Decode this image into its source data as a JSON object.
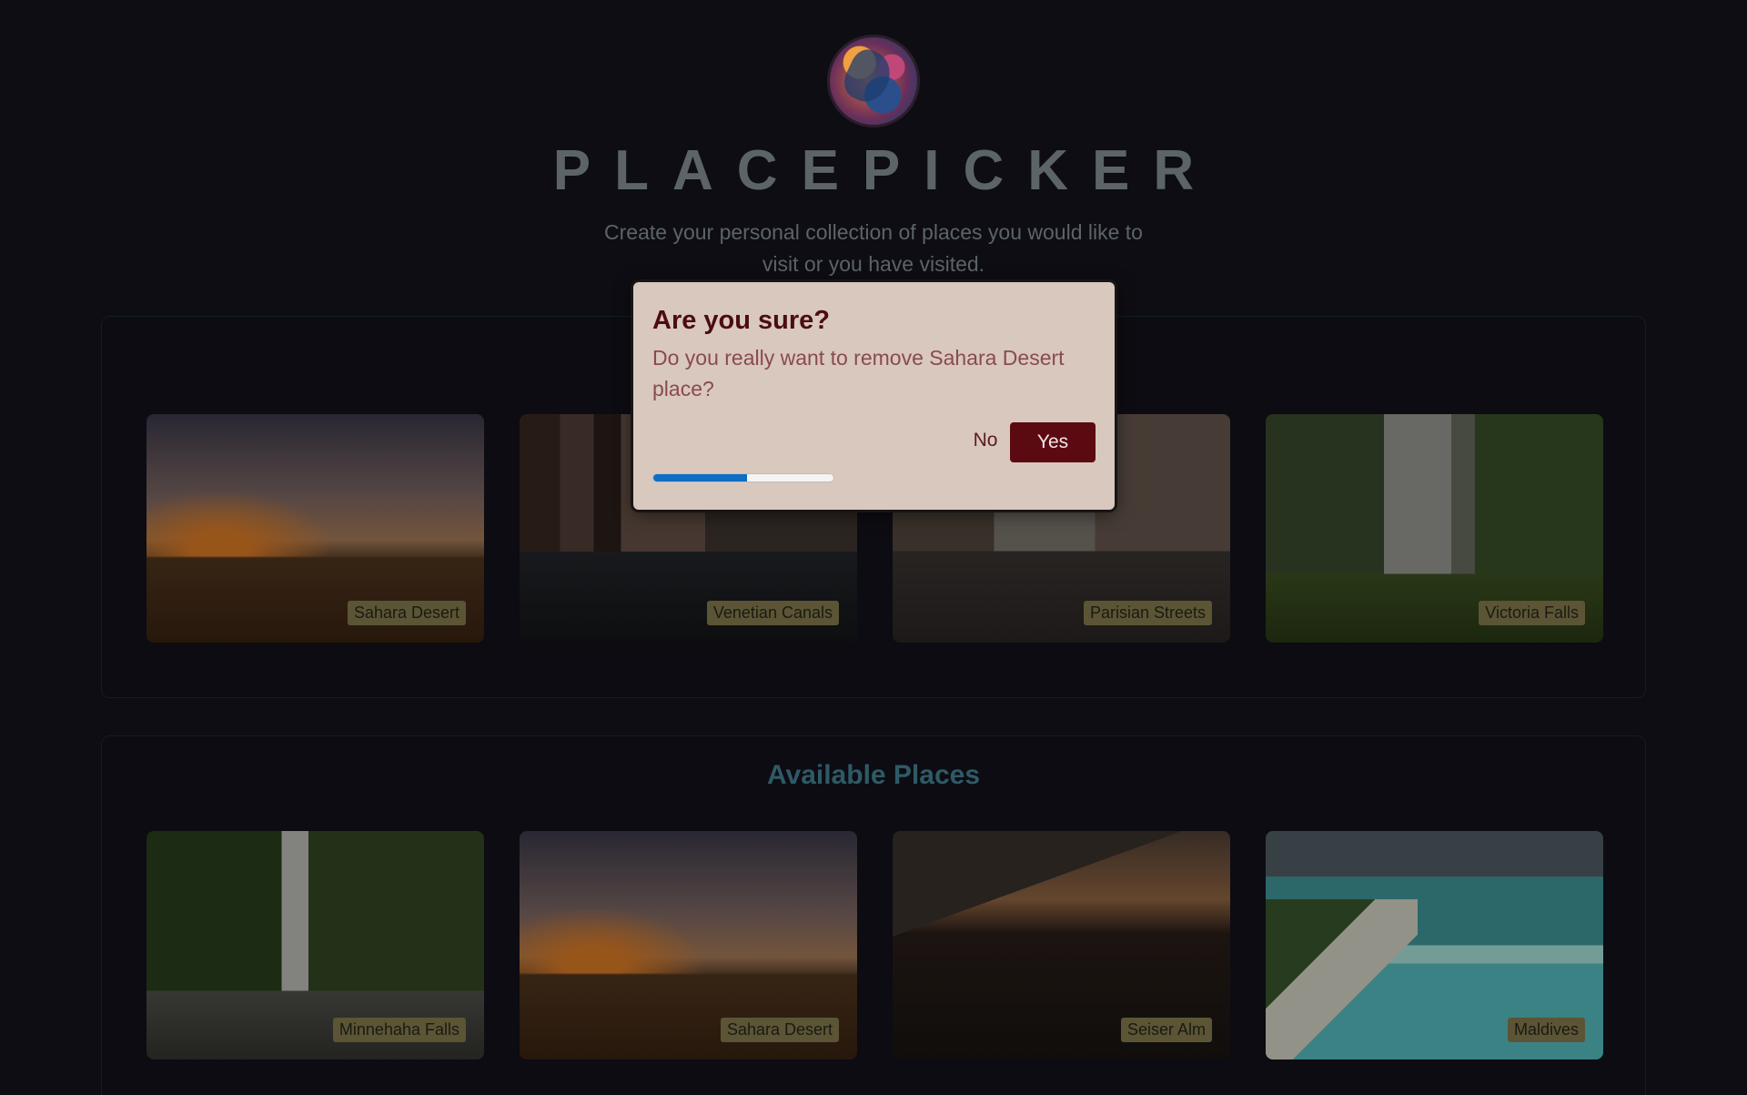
{
  "app": {
    "title": "PLACEPICKER",
    "subtitle": "Create your personal collection of places you would like to visit or you have visited."
  },
  "selected_places": [
    {
      "label": "Sahara Desert"
    },
    {
      "label": "Venetian Canals"
    },
    {
      "label": "Parisian Streets"
    },
    {
      "label": "Victoria Falls"
    }
  ],
  "available": {
    "heading": "Available Places",
    "places": [
      {
        "label": "Minnehaha Falls"
      },
      {
        "label": "Sahara Desert"
      },
      {
        "label": "Seiser Alm"
      },
      {
        "label": "Maldives"
      }
    ]
  },
  "modal": {
    "title": "Are you sure?",
    "message": "Do you really want to remove Sahara Desert place?",
    "no_label": "No",
    "yes_label": "Yes",
    "progress": 0.52
  },
  "colors": {
    "accent": "#5c0a12",
    "progress": "#0d6ec4"
  }
}
